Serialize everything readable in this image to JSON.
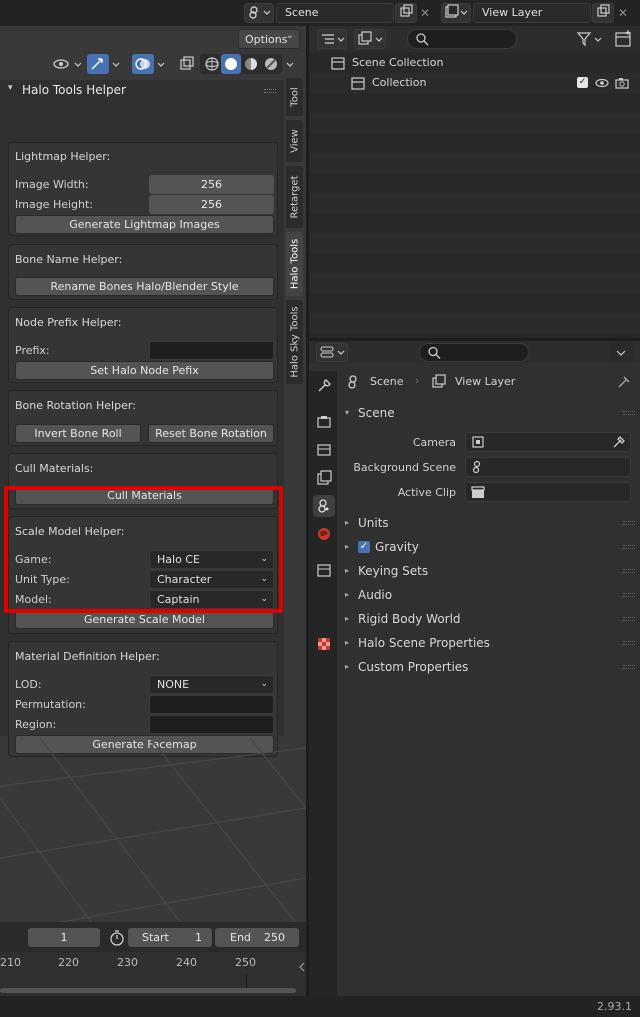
{
  "top_header": {
    "scene_value": "Scene",
    "view_layer_value": "View Layer",
    "close_glyph": "✕"
  },
  "viewport": {
    "options_label": "Options",
    "options_chevron": "⌄"
  },
  "npanel": {
    "title": "Halo Tools Helper",
    "lightmap": {
      "title": "Lightmap Helper:",
      "width_label": "Image Width:",
      "width_value": "256",
      "height_label": "Image Height:",
      "height_value": "256",
      "generate_label": "Generate Lightmap Images"
    },
    "bone_name": {
      "title": "Bone Name Helper:",
      "rename_label": "Rename Bones Halo/Blender Style"
    },
    "node_prefix": {
      "title": "Node Prefix Helper:",
      "prefix_label": "Prefix:",
      "set_label": "Set Halo Node Pefix"
    },
    "bone_rotation": {
      "title": "Bone Rotation Helper:",
      "invert_label": "Invert Bone Roll",
      "reset_label": "Reset Bone Rotation"
    },
    "cull": {
      "title": "Cull Materials:",
      "button_label": "Cull Materials"
    },
    "scale_model": {
      "title": "Scale Model Helper:",
      "game_label": "Game:",
      "game_value": "Halo CE",
      "unit_label": "Unit Type:",
      "unit_value": "Character",
      "model_label": "Model:",
      "model_value": "Captain",
      "generate_label": "Generate Scale Model"
    },
    "material_def": {
      "title": "Material Definition Helper:",
      "lod_label": "LOD:",
      "lod_value": "NONE",
      "perm_label": "Permutation:",
      "region_label": "Region:",
      "generate_label": "Generate Facemap"
    },
    "highlight_color": "#e00000"
  },
  "vertical_tabs": [
    {
      "label": "Tool"
    },
    {
      "label": "View"
    },
    {
      "label": "Retarget"
    },
    {
      "label": "Halo Tools"
    },
    {
      "label": "Halo Sky Tools"
    }
  ],
  "timeline": {
    "current_frame": "1",
    "start_label": "Start",
    "start_value": "1",
    "end_label": "End",
    "end_value": "250",
    "ticks": [
      "210",
      "220",
      "230",
      "240",
      "250"
    ]
  },
  "outliner": {
    "rows": [
      {
        "label": "Scene Collection"
      },
      {
        "label": "Collection"
      }
    ]
  },
  "properties": {
    "breadcrumb_scene": "Scene",
    "breadcrumb_sep": "›",
    "breadcrumb_layer": "View Layer",
    "scene_section": "Scene",
    "camera_label": "Camera",
    "background_label": "Background Scene",
    "active_clip_label": "Active Clip",
    "sections": [
      {
        "label": "Units"
      },
      {
        "label": "Gravity"
      },
      {
        "label": "Keying Sets"
      },
      {
        "label": "Audio"
      },
      {
        "label": "Rigid Body World"
      },
      {
        "label": "Halo Scene Properties"
      },
      {
        "label": "Custom Properties"
      }
    ]
  },
  "status": {
    "version": "2.93.1"
  },
  "colors": {
    "accent_blue": "#4772b3",
    "panel_bg": "#303030"
  },
  "icons": {
    "collapse_open": "▾",
    "collapse_closed": "▸",
    "check": "✓",
    "chevron": "⌄"
  }
}
